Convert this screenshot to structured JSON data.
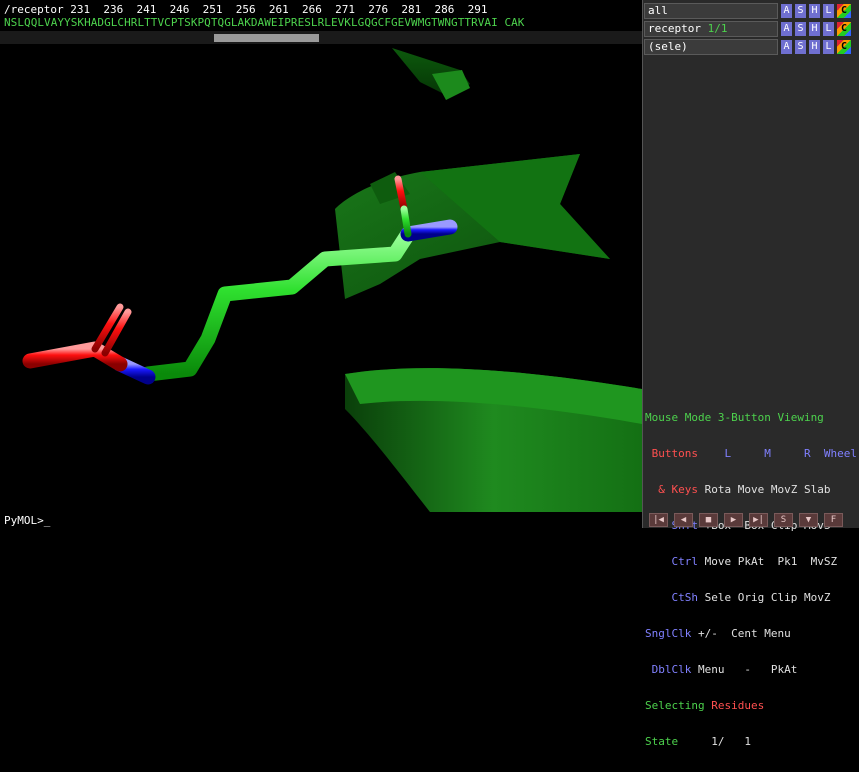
{
  "sequence": {
    "header": "/receptor 231  236  241  246  251  256  261  266  271  276  281  286  291",
    "residues": "NSLQQLVAYYSKHADGLCHRLTTVCPTSKPQTQGLAKDAWEIPRESLRLEVKLGQGCFGEVWMGTWNGTTRVAI CAK"
  },
  "objects": [
    {
      "name": "all",
      "count": "",
      "buttons": [
        "A",
        "S",
        "H",
        "L",
        "C"
      ]
    },
    {
      "name": "receptor",
      "count": "1/1",
      "buttons": [
        "A",
        "S",
        "H",
        "L",
        "C"
      ]
    },
    {
      "name": "(sele)",
      "count": "",
      "buttons": [
        "A",
        "S",
        "H",
        "L",
        "C"
      ]
    }
  ],
  "mouse": {
    "title": "Mouse Mode 3-Button Viewing",
    "buttons_label": "Buttons",
    "L": "L",
    "M": "M",
    "R": "R",
    "wheel": "Wheel",
    "keys_label": "& Keys",
    "rows": [
      {
        "key": "",
        "cells": [
          "Rota",
          "Move",
          "MovZ",
          "Slab"
        ]
      },
      {
        "key": "Shft",
        "cells": [
          "+Box",
          "-Box",
          "Clip",
          "MovS"
        ]
      },
      {
        "key": "Ctrl",
        "cells": [
          "Move",
          "PkAt",
          "Pk1",
          "MvSZ"
        ]
      },
      {
        "key": "CtSh",
        "cells": [
          "Sele",
          "Orig",
          "Clip",
          "MovZ"
        ]
      },
      {
        "key": "SnglClk",
        "cells": [
          "+/-",
          "Cent",
          "Menu",
          ""
        ]
      },
      {
        "key": "DblClk",
        "cells": [
          "Menu",
          "-",
          "PkAt",
          ""
        ]
      }
    ],
    "selecting": "Selecting",
    "selecting_what": "Residues",
    "state_label": "State",
    "state_value": "1/",
    "state_total": "1"
  },
  "command": {
    "prompt": "PyMOL>_"
  },
  "vcr_buttons": [
    "|◀",
    "◀",
    "■",
    "▶",
    "▶|",
    "S",
    "▼",
    "F"
  ]
}
